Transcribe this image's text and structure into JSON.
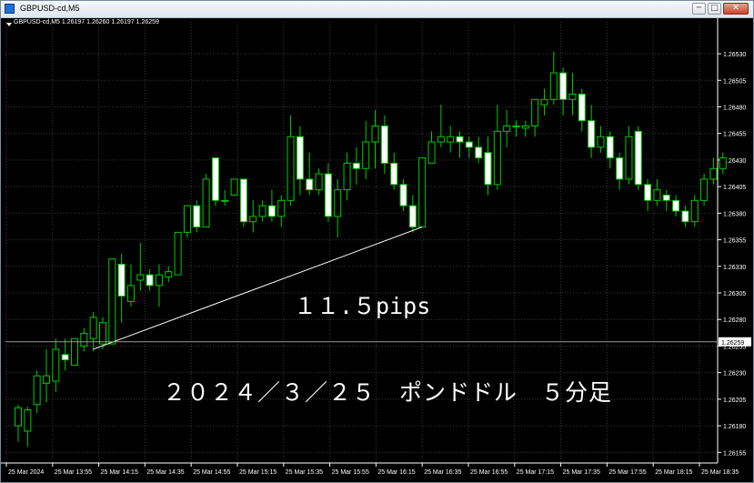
{
  "window": {
    "title": "GBPUSD-cd,M5",
    "buttons": {
      "minimize": "─",
      "maximize": "□",
      "close": "✕"
    }
  },
  "info_line": "GBPUSD-cd,M5  1.26197 1.26260 1.26197 1.26259",
  "colors": {
    "background": "#000000",
    "up_body": "#000000",
    "down_body": "#ffffff",
    "wick": "#00cc00",
    "grid": "#3a3a3a",
    "axis_text": "#ffffff",
    "trendline": "#ffffff"
  },
  "chart_data": {
    "type": "candlestick",
    "symbol": "GBPUSD-cd",
    "timeframe": "M5",
    "ylim": [
      1.26145,
      1.2656
    ],
    "y_ticks": [
      "1.26530",
      "1.26505",
      "1.26480",
      "1.26455",
      "1.26430",
      "1.26405",
      "1.26380",
      "1.26355",
      "1.26330",
      "1.26305",
      "1.26280",
      "1.26255",
      "1.26230",
      "1.26205",
      "1.26180",
      "1.26155"
    ],
    "x_labels": [
      "25 Mar 2024",
      "25 Mar 13:55",
      "25 Mar 14:15",
      "25 Mar 14:35",
      "25 Mar 14:55",
      "25 Mar 15:15",
      "25 Mar 15:35",
      "25 Mar 15:55",
      "25 Mar 16:15",
      "25 Mar 16:35",
      "25 Mar 16:55",
      "25 Mar 17:15",
      "25 Mar 17:35",
      "25 Mar 17:55",
      "25 Mar 18:15",
      "25 Mar 18:35"
    ],
    "current_price": "1.26259",
    "candles": [
      [
        1.2618,
        1.26197,
        1.26165,
        1.262
      ],
      [
        1.26175,
        1.26195,
        1.2616,
        1.26198
      ],
      [
        1.262,
        1.26227,
        1.26192,
        1.26232
      ],
      [
        1.2622,
        1.26227,
        1.26202,
        1.26252
      ],
      [
        1.26222,
        1.26252,
        1.26212,
        1.26262
      ],
      [
        1.26247,
        1.26242,
        1.26232,
        1.26262
      ],
      [
        1.26237,
        1.26262,
        1.26237,
        1.26262
      ],
      [
        1.26255,
        1.26267,
        1.2625,
        1.26272
      ],
      [
        1.26262,
        1.26282,
        1.2625,
        1.26287
      ],
      [
        1.26257,
        1.26277,
        1.26252,
        1.26282
      ],
      [
        1.26257,
        1.26337,
        1.26257,
        1.26337
      ],
      [
        1.26332,
        1.26302,
        1.26277,
        1.26342
      ],
      [
        1.26297,
        1.26312,
        1.26292,
        1.26332
      ],
      [
        1.26317,
        1.26322,
        1.26307,
        1.26352
      ],
      [
        1.26322,
        1.26312,
        1.26307,
        1.26327
      ],
      [
        1.26312,
        1.26322,
        1.26292,
        1.26332
      ],
      [
        1.2632,
        1.26325,
        1.26315,
        1.2633
      ],
      [
        1.26322,
        1.26362,
        1.26322,
        1.26362
      ],
      [
        1.26362,
        1.26387,
        1.26357,
        1.26387
      ],
      [
        1.26387,
        1.26367,
        1.26362,
        1.26392
      ],
      [
        1.26367,
        1.26412,
        1.26367,
        1.26417
      ],
      [
        1.26432,
        1.26392,
        1.26387,
        1.26432
      ],
      [
        1.26392,
        1.26392,
        1.26387,
        1.26402
      ],
      [
        1.26397,
        1.26412,
        1.26397,
        1.26412
      ],
      [
        1.26412,
        1.26372,
        1.26367,
        1.26412
      ],
      [
        1.26372,
        1.26377,
        1.26362,
        1.26392
      ],
      [
        1.26377,
        1.26387,
        1.26372,
        1.26392
      ],
      [
        1.26387,
        1.26377,
        1.26372,
        1.26402
      ],
      [
        1.26377,
        1.26392,
        1.26367,
        1.26397
      ],
      [
        1.26392,
        1.26452,
        1.26387,
        1.26472
      ],
      [
        1.26452,
        1.26412,
        1.26397,
        1.26462
      ],
      [
        1.26412,
        1.26402,
        1.26397,
        1.26437
      ],
      [
        1.26402,
        1.26417,
        1.26397,
        1.26422
      ],
      [
        1.26417,
        1.26377,
        1.26372,
        1.26427
      ],
      [
        1.26377,
        1.26402,
        1.26357,
        1.26412
      ],
      [
        1.26402,
        1.26427,
        1.26392,
        1.26437
      ],
      [
        1.26427,
        1.26422,
        1.26407,
        1.26442
      ],
      [
        1.26422,
        1.26447,
        1.26412,
        1.26467
      ],
      [
        1.26447,
        1.26462,
        1.26422,
        1.26477
      ],
      [
        1.26462,
        1.26427,
        1.26417,
        1.26472
      ],
      [
        1.26427,
        1.26407,
        1.26402,
        1.26437
      ],
      [
        1.26407,
        1.26387,
        1.26382,
        1.26412
      ],
      [
        1.26387,
        1.26367,
        1.26362,
        1.26397
      ],
      [
        1.26367,
        1.26432,
        1.26367,
        1.26432
      ],
      [
        1.26427,
        1.26447,
        1.26427,
        1.26457
      ],
      [
        1.26447,
        1.26452,
        1.26442,
        1.26482
      ],
      [
        1.26447,
        1.26452,
        1.26437,
        1.26462
      ],
      [
        1.26452,
        1.26447,
        1.26432,
        1.26457
      ],
      [
        1.26447,
        1.26442,
        1.26432,
        1.26452
      ],
      [
        1.26442,
        1.26432,
        1.26427,
        1.26452
      ],
      [
        1.26437,
        1.26407,
        1.26397,
        1.26452
      ],
      [
        1.26407,
        1.26457,
        1.26402,
        1.26482
      ],
      [
        1.26457,
        1.26462,
        1.26442,
        1.26477
      ],
      [
        1.26462,
        1.26462,
        1.26452,
        1.26467
      ],
      [
        1.2646,
        1.26462,
        1.26452,
        1.26467
      ],
      [
        1.26462,
        1.26487,
        1.26452,
        1.26487
      ],
      [
        1.26482,
        1.26487,
        1.26472,
        1.26497
      ],
      [
        1.26487,
        1.26512,
        1.26482,
        1.26532
      ],
      [
        1.26512,
        1.26487,
        1.26472,
        1.26517
      ],
      [
        1.26487,
        1.26492,
        1.26472,
        1.26512
      ],
      [
        1.26492,
        1.26467,
        1.26457,
        1.26497
      ],
      [
        1.26467,
        1.26442,
        1.26432,
        1.26482
      ],
      [
        1.26442,
        1.26452,
        1.26437,
        1.26462
      ],
      [
        1.26452,
        1.26432,
        1.26422,
        1.26457
      ],
      [
        1.26432,
        1.26412,
        1.26402,
        1.26437
      ],
      [
        1.26412,
        1.26452,
        1.26407,
        1.26462
      ],
      [
        1.26457,
        1.26407,
        1.26402,
        1.26462
      ],
      [
        1.26407,
        1.26392,
        1.26382,
        1.26412
      ],
      [
        1.26392,
        1.26402,
        1.26387,
        1.26412
      ],
      [
        1.26397,
        1.26392,
        1.26382,
        1.26402
      ],
      [
        1.26392,
        1.26382,
        1.26377,
        1.26397
      ],
      [
        1.26382,
        1.26372,
        1.26367,
        1.26387
      ],
      [
        1.26372,
        1.26392,
        1.26367,
        1.26397
      ],
      [
        1.26392,
        1.26412,
        1.26387,
        1.26417
      ],
      [
        1.26412,
        1.26422,
        1.26407,
        1.26432
      ],
      [
        1.26422,
        1.26432,
        1.26417,
        1.26437
      ]
    ],
    "trendline": {
      "from_candle": 8,
      "from_price": 1.26252,
      "to_candle": 43,
      "to_price": 1.26367
    },
    "annotations": {
      "pips": "１１.５pips",
      "title": "２０２４／３／２５　ポンドドル　５分足"
    }
  }
}
